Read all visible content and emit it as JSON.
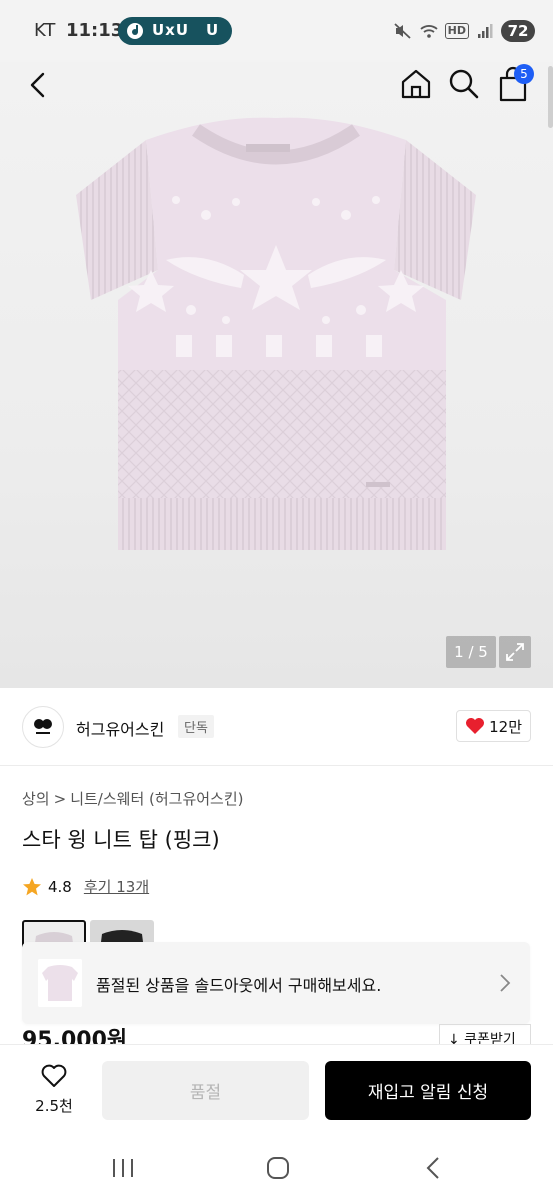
{
  "status_bar": {
    "carrier": "KT",
    "time": "11:13",
    "pill_text": "UxU",
    "pill_text2": "U",
    "hd_label": "HD",
    "battery": "72"
  },
  "header": {
    "cart_count": "5"
  },
  "gallery": {
    "counter": "1 / 5"
  },
  "brand": {
    "name": "허그유어스킨",
    "tag": "단독",
    "likes": "12만"
  },
  "product": {
    "breadcrumb_category": "상의",
    "breadcrumb_separator": ">",
    "breadcrumb_sub": "니트/스웨터 (허그유어스킨)",
    "title": "스타 윙 니트 탑 (핑크)",
    "rating": "4.8",
    "review_link": "후기 13개",
    "price": "95,000원",
    "coupon": "↓ 쿠폰받기"
  },
  "soldout_banner": {
    "text": "품절된 상품을 솔드아웃에서 구매해보세요."
  },
  "bottom_bar": {
    "wish_count": "2.5천",
    "soldout_label": "품절",
    "restock_label": "재입고 알림 신청"
  },
  "colors": {
    "accent_blue": "#1e5ef5",
    "heart_red": "#e8202e",
    "star_orange": "#f5a623",
    "pill_teal": "#17525e",
    "product_pink": "#e8dce6"
  }
}
